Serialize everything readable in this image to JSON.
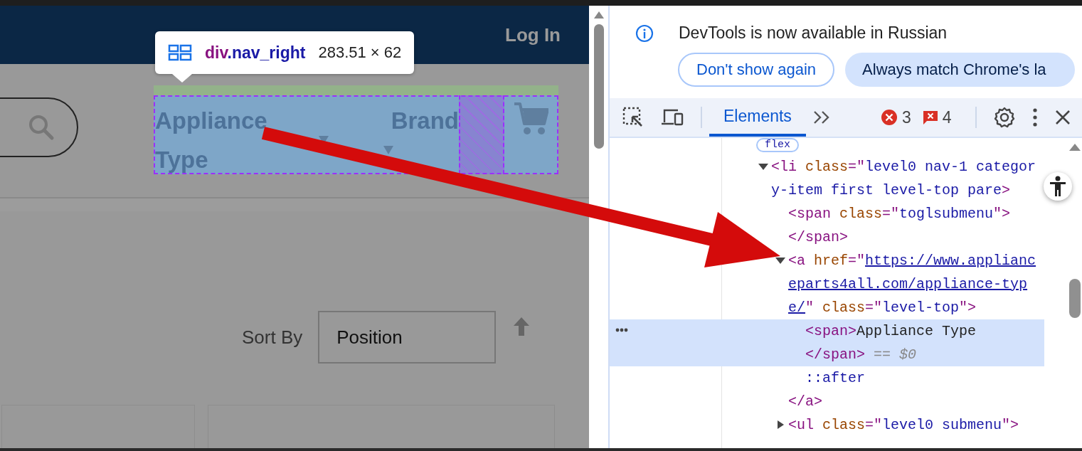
{
  "page": {
    "header_links": [
      "Log In"
    ],
    "inspect_tooltip": {
      "tag": "div",
      "class_name": ".nav_right",
      "size": "283.51 × 62"
    },
    "nav_items": [
      {
        "label": "Appliance Type"
      },
      {
        "label": "Brand"
      }
    ],
    "sort": {
      "label": "Sort By",
      "value": "Position"
    }
  },
  "devtools": {
    "infobar": {
      "message": "DevTools is now available in Russian",
      "buttons": [
        {
          "label": "Don't show again",
          "kind": "outline"
        },
        {
          "label": "Always match Chrome's la",
          "kind": "filled"
        }
      ]
    },
    "tabs": [
      {
        "label": "Elements",
        "selected": true
      }
    ],
    "errors": "3",
    "issues": "4",
    "badge": "flex",
    "tree": [
      {
        "expanded": true,
        "selected": false,
        "tokens": [
          {
            "kind": "tag",
            "text": "<li "
          },
          {
            "kind": "attr",
            "text": "class"
          },
          {
            "kind": "tag",
            "text": "=\""
          },
          {
            "kind": "value",
            "text": "level0 nav-1 category-item first level-top pare"
          },
          {
            "kind": "tag",
            "text": ">"
          }
        ],
        "children": [
          {
            "selected": false,
            "tokens": [
              {
                "kind": "tag",
                "text": "<span "
              },
              {
                "kind": "attr",
                "text": "class"
              },
              {
                "kind": "tag",
                "text": "=\""
              },
              {
                "kind": "value",
                "text": "toglsubmenu"
              },
              {
                "kind": "tag",
                "text": "\">"
              }
            ],
            "closing": [
              {
                "kind": "tag",
                "text": "</span>"
              }
            ]
          },
          {
            "expanded": true,
            "selected": false,
            "tokens": [
              {
                "kind": "tag",
                "text": "<a "
              },
              {
                "kind": "attr",
                "text": "href"
              },
              {
                "kind": "tag",
                "text": "=\""
              },
              {
                "kind": "link",
                "text": "https://www.applianceparts4all.com/appliance-type/"
              },
              {
                "kind": "tag",
                "text": "\" "
              },
              {
                "kind": "attr",
                "text": "class"
              },
              {
                "kind": "tag",
                "text": "=\""
              },
              {
                "kind": "value",
                "text": "level-top"
              },
              {
                "kind": "tag",
                "text": "\">"
              }
            ],
            "children": [
              {
                "selected": true,
                "tokens": [
                  {
                    "kind": "tag",
                    "text": "<span>"
                  },
                  {
                    "kind": "text",
                    "text": "Appliance Type"
                  }
                ],
                "closing": [
                  {
                    "kind": "tag",
                    "text": "</span>"
                  },
                  {
                    "kind": "dim",
                    "text": " == $0"
                  }
                ]
              },
              {
                "selected": false,
                "tokens": [
                  {
                    "kind": "value",
                    "text": "::after"
                  }
                ]
              }
            ],
            "closing": [
              {
                "kind": "tag",
                "text": "</a>"
              }
            ]
          },
          {
            "expanded": false,
            "selected": false,
            "tokens": [
              {
                "kind": "tag",
                "text": "<ul "
              },
              {
                "kind": "attr",
                "text": "class"
              },
              {
                "kind": "tag",
                "text": "=\""
              },
              {
                "kind": "value",
                "text": "level0 submenu"
              },
              {
                "kind": "tag",
                "text": "\">"
              }
            ]
          }
        ]
      }
    ]
  }
}
